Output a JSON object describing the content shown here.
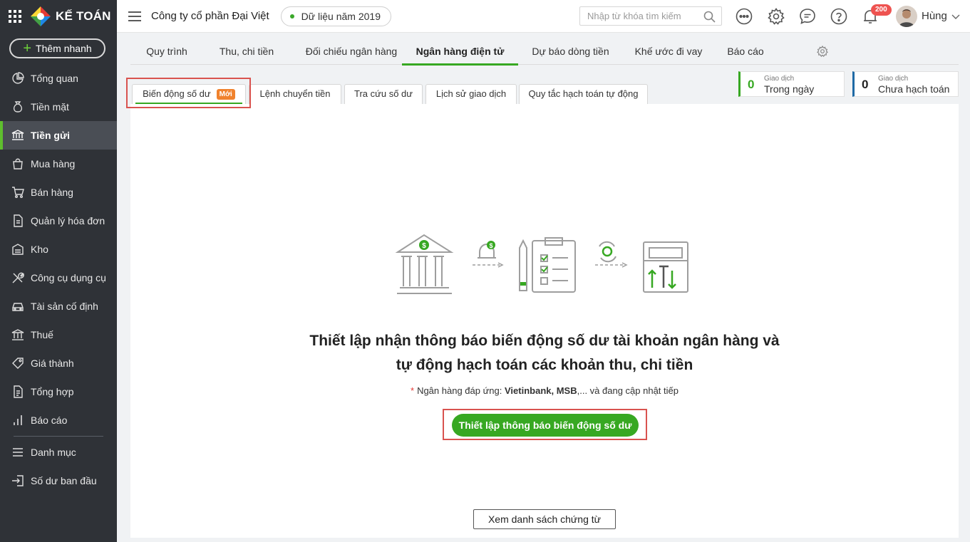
{
  "brand": {
    "name": "KẾ TOÁN"
  },
  "sidebar": {
    "quick_add_label": "Thêm nhanh",
    "items": [
      {
        "label": "Tổng quan",
        "icon": "pie-chart-icon"
      },
      {
        "label": "Tiền mặt",
        "icon": "money-bag-icon"
      },
      {
        "label": "Tiền gửi",
        "icon": "bank-icon",
        "active": true
      },
      {
        "label": "Mua hàng",
        "icon": "shopping-bag-icon"
      },
      {
        "label": "Bán hàng",
        "icon": "cart-icon"
      },
      {
        "label": "Quản lý hóa đơn",
        "icon": "invoice-icon"
      },
      {
        "label": "Kho",
        "icon": "warehouse-icon"
      },
      {
        "label": "Công cụ dụng cụ",
        "icon": "tools-icon"
      },
      {
        "label": "Tài sản cố định",
        "icon": "car-icon"
      },
      {
        "label": "Thuế",
        "icon": "tax-icon"
      },
      {
        "label": "Giá thành",
        "icon": "price-tag-icon"
      },
      {
        "label": "Tổng hợp",
        "icon": "summary-icon"
      },
      {
        "label": "Báo cáo",
        "icon": "bar-chart-icon"
      }
    ],
    "secondary_items": [
      {
        "label": "Danh mục",
        "icon": "list-icon"
      },
      {
        "label": "Số dư ban đầu",
        "icon": "import-icon"
      }
    ]
  },
  "header": {
    "company": "Công ty cổ phần Đại Việt",
    "data_year": "Dữ liệu năm 2019",
    "search_placeholder": "Nhập từ khóa tìm kiếm",
    "notification_count": "200",
    "user_name": "Hùng"
  },
  "main_tabs": [
    {
      "label": "Quy trình"
    },
    {
      "label": "Thu, chi tiền"
    },
    {
      "label": "Đối chiếu ngân hàng"
    },
    {
      "label": "Ngân hàng điện tử",
      "active": true
    },
    {
      "label": "Dự báo dòng tiền"
    },
    {
      "label": "Khế ước đi vay"
    },
    {
      "label": "Báo cáo"
    }
  ],
  "sub_tabs": [
    {
      "label": "Biến động số dư",
      "badge": "Mới",
      "active": true
    },
    {
      "label": "Lệnh chuyển tiền"
    },
    {
      "label": "Tra cứu số dư"
    },
    {
      "label": "Lịch sử giao dịch"
    },
    {
      "label": "Quy tắc hạch toán tự động"
    }
  ],
  "stats": [
    {
      "count": "0",
      "caption": "Giao dịch",
      "label": "Trong ngày",
      "color": "#37a822"
    },
    {
      "count": "0",
      "caption": "Giao dịch",
      "label": "Chưa hạch toán",
      "color": "#1f6aa5"
    }
  ],
  "content": {
    "headline_line1": "Thiết lập nhận thông báo biến động số dư tài khoản ngân hàng và",
    "headline_line2": "tự động hạch toán các khoản thu, chi tiền",
    "note_star": "*",
    "note_prefix": "Ngân hàng đáp ứng: ",
    "note_banks": "Vietinbank, MSB",
    "note_suffix": ",... và đang cập nhật tiếp",
    "setup_button": "Thiết lập thông báo biến động số dư",
    "view_docs_button": "Xem danh sách chứng từ"
  },
  "colors": {
    "accent": "#37a822",
    "sidebar_bg": "#2f3237",
    "highlight": "#d9534f",
    "badge": "#f0822d"
  }
}
